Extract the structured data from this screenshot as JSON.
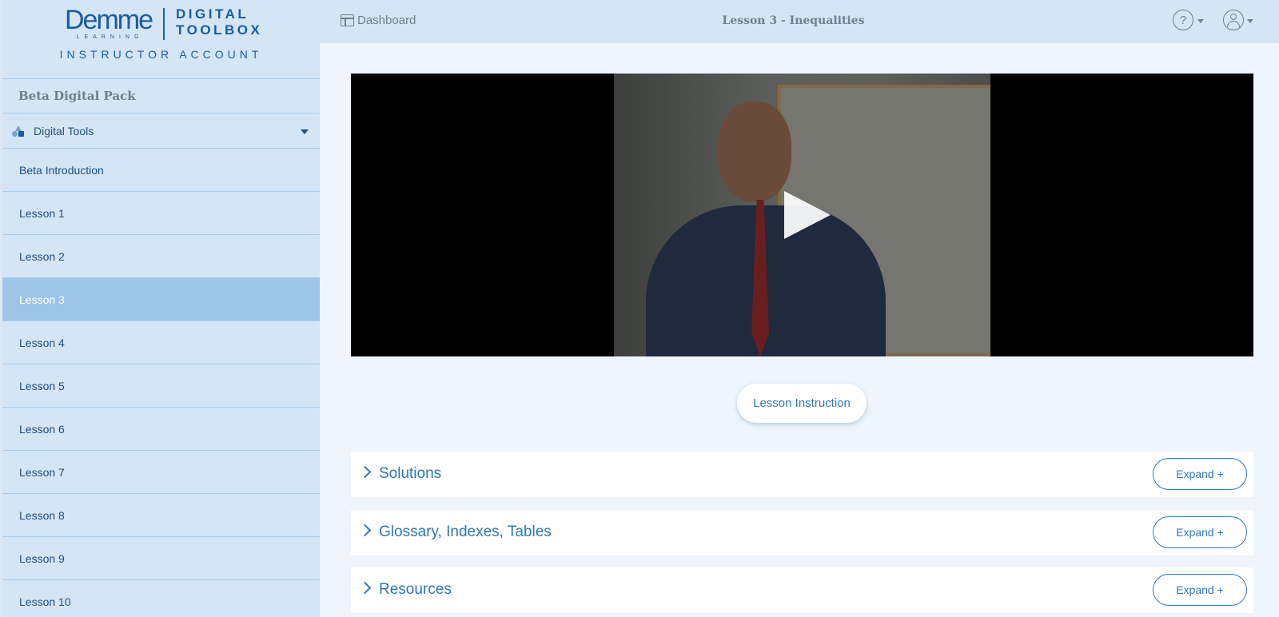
{
  "brand": {
    "logo_word": "Demme",
    "logo_sub": "LEARNING",
    "toolbox_line1": "DIGITAL",
    "toolbox_line2": "TOOLBOX",
    "account": "INSTRUCTOR ACCOUNT"
  },
  "sidebar": {
    "pack_title": "Beta Digital Pack",
    "tools_label": "Digital Tools",
    "items": [
      {
        "label": "Beta Introduction",
        "active": false
      },
      {
        "label": "Lesson 1",
        "active": false
      },
      {
        "label": "Lesson 2",
        "active": false
      },
      {
        "label": "Lesson 3",
        "active": true
      },
      {
        "label": "Lesson 4",
        "active": false
      },
      {
        "label": "Lesson 5",
        "active": false
      },
      {
        "label": "Lesson 6",
        "active": false
      },
      {
        "label": "Lesson 7",
        "active": false
      },
      {
        "label": "Lesson 8",
        "active": false
      },
      {
        "label": "Lesson 9",
        "active": false
      },
      {
        "label": "Lesson 10",
        "active": false
      }
    ]
  },
  "header": {
    "dashboard_label": "Dashboard",
    "lesson_title": "Lesson 3 - Inequalities",
    "help_glyph": "?"
  },
  "main": {
    "lesson_instruction_label": "Lesson Instruction",
    "sections": [
      {
        "title": "Solutions",
        "expand_label": "Expand +"
      },
      {
        "title": "Glossary, Indexes, Tables",
        "expand_label": "Expand +"
      },
      {
        "title": "Resources",
        "expand_label": "Expand +"
      }
    ]
  },
  "icons": {
    "dashboard": "dashboard-icon",
    "help": "help-icon",
    "user": "user-icon",
    "play": "play-icon",
    "tools": "shapes-icon",
    "chevron": "chevron-right-icon"
  },
  "colors": {
    "sidebar_bg": "#d4e5f5",
    "active_item": "#9ec4e8",
    "accent": "#2f78b4",
    "brand": "#1c5b9f"
  }
}
